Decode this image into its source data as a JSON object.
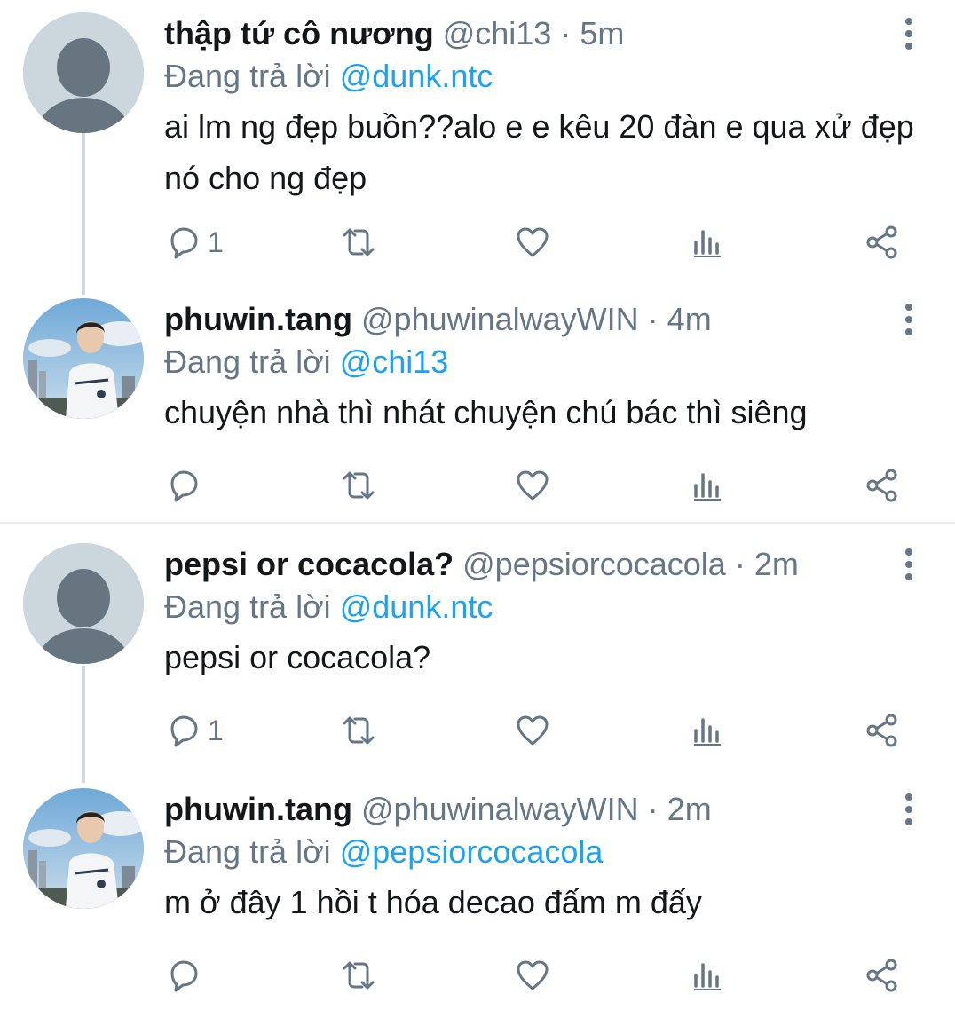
{
  "tweets": [
    {
      "display_name": "thập tứ cô nương",
      "handle": "@chi13",
      "time": "5m",
      "replying_prefix": "Đang trả lời",
      "replying_to": "@dunk.ntc",
      "text": "ai lm ng đẹp buồn??alo e e kêu 20 đàn e qua xử đẹp nó cho ng đẹp",
      "reply_count": "1",
      "avatar": "default-avatar-icon"
    },
    {
      "display_name": "phuwin.tang",
      "handle": "@phuwinalwayWIN",
      "time": "4m",
      "replying_prefix": "Đang trả lời",
      "replying_to": "@chi13",
      "text": "chuyện nhà thì nhát chuyện chú bác thì siêng",
      "reply_count": "",
      "avatar": "profile-photo"
    },
    {
      "display_name": "pepsi or cocacola?",
      "handle": "@pepsiorcocacola",
      "time": "2m",
      "replying_prefix": "Đang trả lời",
      "replying_to": "@dunk.ntc",
      "text": "pepsi or cocacola?",
      "reply_count": "1",
      "avatar": "default-avatar-icon"
    },
    {
      "display_name": "phuwin.tang",
      "handle": "@phuwinalwayWIN",
      "time": "2m",
      "replying_prefix": "Đang trả lời",
      "replying_to": "@pepsiorcocacola",
      "text": "m ở đây 1 hồi t hóa decao đấm m đấy",
      "reply_count": "",
      "avatar": "profile-photo"
    }
  ],
  "separator": "·",
  "colors": {
    "link": "#1da1f2",
    "muted": "#657786",
    "text": "#14171a",
    "thread_line": "#cfd9de"
  },
  "icons": [
    "reply-icon",
    "retweet-icon",
    "like-icon",
    "analytics-icon",
    "share-icon",
    "more-options-icon"
  ]
}
